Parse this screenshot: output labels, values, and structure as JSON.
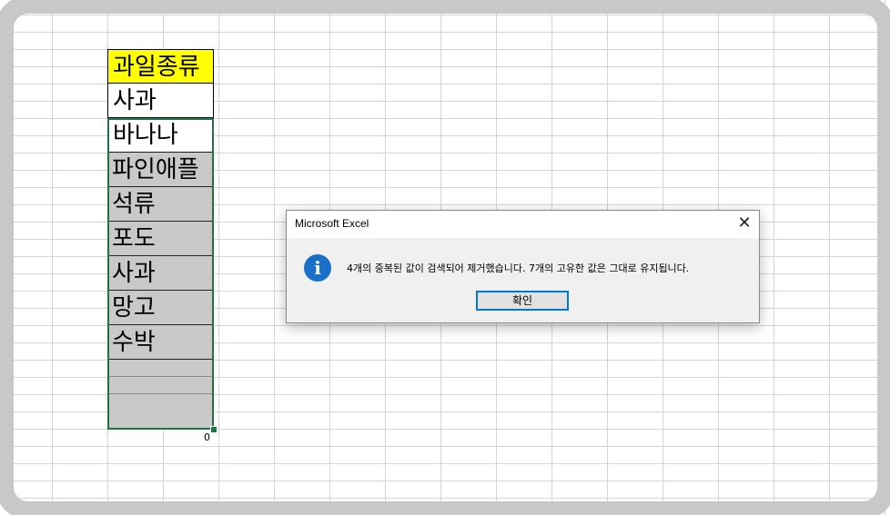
{
  "column": {
    "header": "과일종류",
    "items": [
      "사과",
      "바나나",
      "파인애플",
      "석류",
      "포도",
      "사과",
      "망고",
      "수박",
      "",
      ""
    ],
    "quick_analysis_label": "0"
  },
  "dialog": {
    "title": "Microsoft Excel",
    "close_glyph": "✕",
    "icon": "info-icon",
    "icon_glyph": "i",
    "message": "4개의 중복된 값이 검색되어 제거했습니다. 7개의 고유한 값은 그대로 유지됩니다.",
    "ok_label": "확인"
  },
  "colors": {
    "header_fill": "#ffff00",
    "selection_fill": "#c9c9c9",
    "selection_border": "#217346",
    "info_icon": "#1a70c8",
    "button_focus": "#0078d7"
  }
}
